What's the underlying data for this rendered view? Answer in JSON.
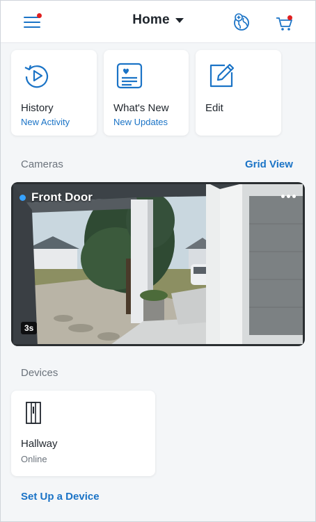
{
  "header": {
    "title": "Home",
    "menu_icon": "hamburger-menu-icon",
    "globe_icon": "globe-plus-icon",
    "cart_icon": "shopping-cart-icon",
    "accent_color": "#1a73c6",
    "alert_color": "#e02020"
  },
  "tiles": [
    {
      "label": "History",
      "sub": "New Activity",
      "icon": "history-clock-icon"
    },
    {
      "label": "What's New",
      "sub": "New Updates",
      "icon": "news-card-icon"
    },
    {
      "label": "Edit",
      "icon": "edit-pencil-icon"
    }
  ],
  "cameras": {
    "section_label": "Cameras",
    "view_link": "Grid View",
    "items": [
      {
        "name": "Front Door",
        "age": "3s",
        "status_color": "#36a2ff"
      }
    ]
  },
  "devices": {
    "section_label": "Devices",
    "items": [
      {
        "name": "Hallway",
        "status": "Online",
        "icon": "door-contact-sensor-icon"
      }
    ],
    "setup_link": "Set Up a Device"
  }
}
